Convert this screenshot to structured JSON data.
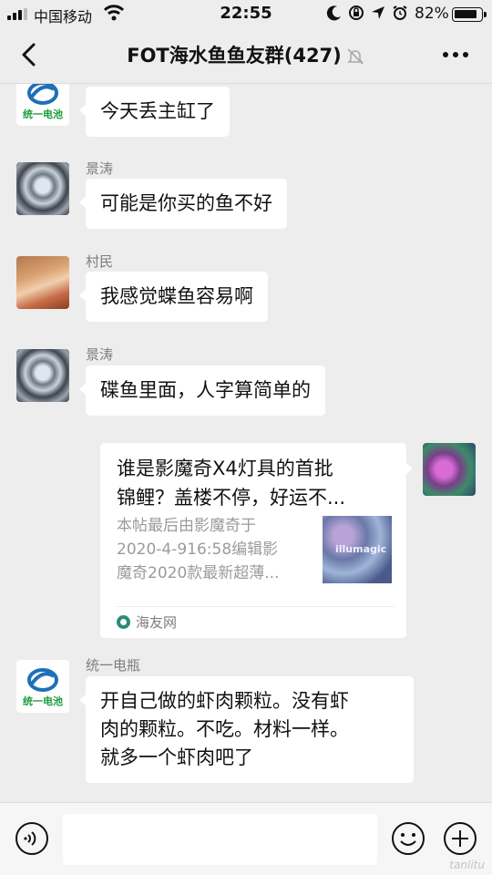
{
  "status_bar": {
    "carrier": "中国移动",
    "time": "22:55",
    "battery": "82%",
    "battery_level": 0.82,
    "icons": [
      "moon-icon",
      "orientation-lock-icon",
      "location-icon",
      "alarm-icon"
    ]
  },
  "header": {
    "title": "FOT海水鱼鱼友群(427)",
    "back_icon": "back-chevron-icon",
    "mute_icon": "mute-bell-icon",
    "more_icon": "more-dots-icon"
  },
  "messages": [
    {
      "sender": "",
      "avatar": "logo",
      "logo_text": "统一电池",
      "lines": [
        "今天丢主缸了"
      ]
    },
    {
      "sender": "景涛",
      "avatar": "dragon",
      "lines": [
        "可能是你买的鱼不好"
      ]
    },
    {
      "sender": "村民",
      "avatar": "girl",
      "lines": [
        "我感觉蝶鱼容易啊"
      ]
    },
    {
      "sender": "景涛",
      "avatar": "dragon",
      "lines": [
        "碟鱼里面，人字算简单的"
      ]
    },
    {
      "sender": "",
      "avatar": "fish",
      "type": "link",
      "title_lines": [
        "谁是影魔奇X4灯具的首批",
        "锦鲤？盖楼不停，好运不..."
      ],
      "desc_lines": [
        "本帖最后由影魔奇于",
        "2020-4-916:58编辑影",
        "魔奇2020款最新超薄..."
      ],
      "thumb_text": "illumagic",
      "source": "海友网"
    },
    {
      "sender": "统一电瓶",
      "avatar": "logo",
      "logo_text": "统一电池",
      "lines": [
        "开自己做的虾肉颗粒。没有虾",
        "肉的颗粒。不吃。材料一样。",
        "就多一个虾肉吧了"
      ]
    }
  ],
  "input_bar": {
    "voice_icon": "voice-icon",
    "emoji_icon": "emoji-icon",
    "plus_icon": "plus-icon",
    "placeholder": ""
  },
  "watermark": "tanlitu"
}
